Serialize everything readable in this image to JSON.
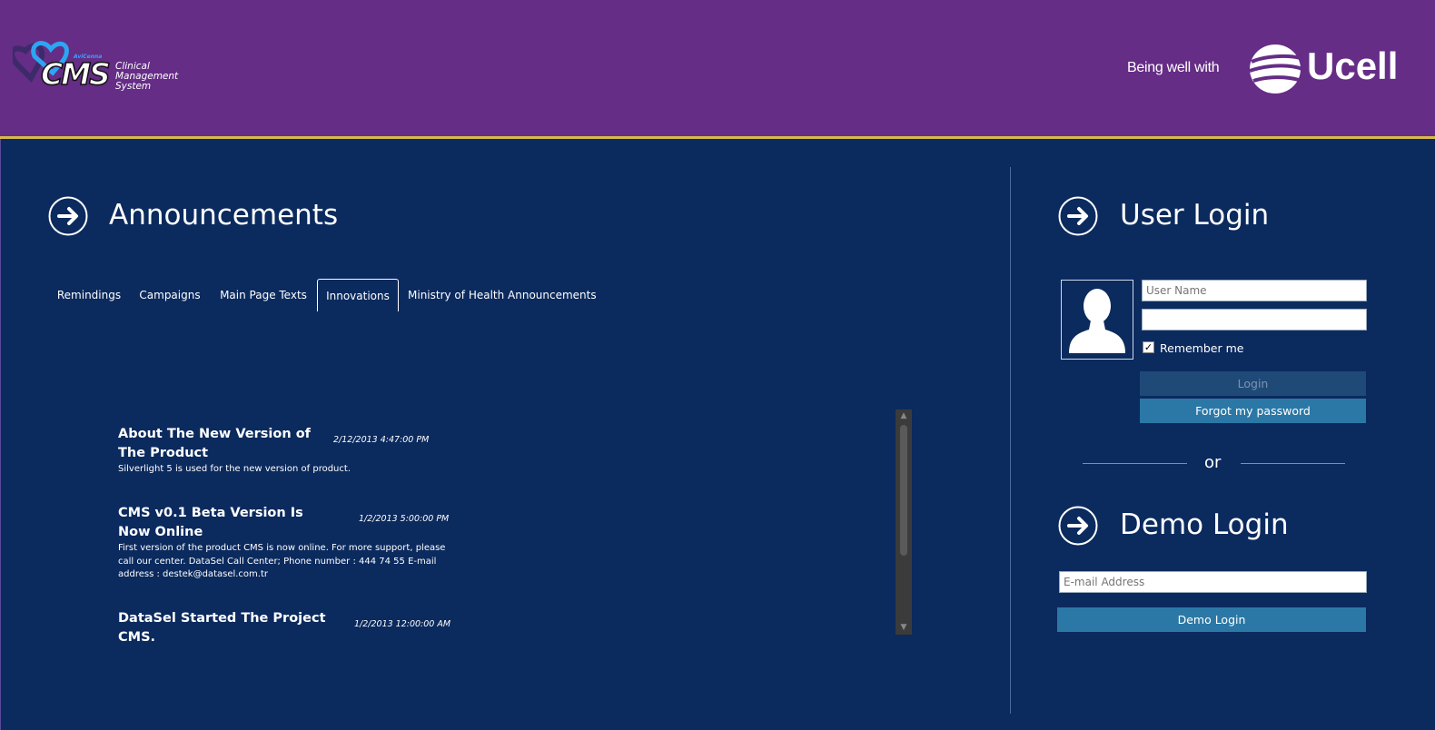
{
  "header": {
    "logo": {
      "brand_small": "AviCenna",
      "brand": "CMS",
      "description": "Clinical Management System"
    },
    "tagline": "Being well with",
    "partner_logo": "Ucell"
  },
  "announcements": {
    "title": "Announcements",
    "tabs": [
      {
        "label": "Remindings",
        "active": false
      },
      {
        "label": "Campaigns",
        "active": false
      },
      {
        "label": "Main Page Texts",
        "active": false
      },
      {
        "label": "Innovations",
        "active": true
      },
      {
        "label": "Ministry of Health Announcements",
        "active": false
      }
    ],
    "items": [
      {
        "title": "About The New Version of The Product",
        "date": "2/12/2013 4:47:00 PM",
        "body": "Silverlight 5 is used for the new version of product."
      },
      {
        "title": "CMS v0.1 Beta Version Is Now Online",
        "date": "1/2/2013 5:00:00 PM",
        "body": "First version of the product CMS is now online. For more support, please call our center. DataSel Call Center; Phone number : 444 74 55 E-mail address : destek@datasel.com.tr"
      },
      {
        "title": "DataSel Started The Project CMS.",
        "date": "1/2/2013 12:00:00 AM",
        "body": ""
      }
    ]
  },
  "login": {
    "title": "User Login",
    "username_placeholder": "User Name",
    "password_value": "",
    "remember_label": "Remember me",
    "remember_checked": true,
    "login_button": "Login",
    "forgot_button": "Forgot my password",
    "or_text": "or"
  },
  "demo": {
    "title": "Demo Login",
    "email_placeholder": "E-mail Address",
    "button": "Demo Login"
  },
  "colors": {
    "header_bg": "#652d86",
    "accent_line": "#d8b94a",
    "main_bg": "#0b2a5e",
    "button_primary": "#2b78a6",
    "button_disabled": "#1f4a78"
  }
}
